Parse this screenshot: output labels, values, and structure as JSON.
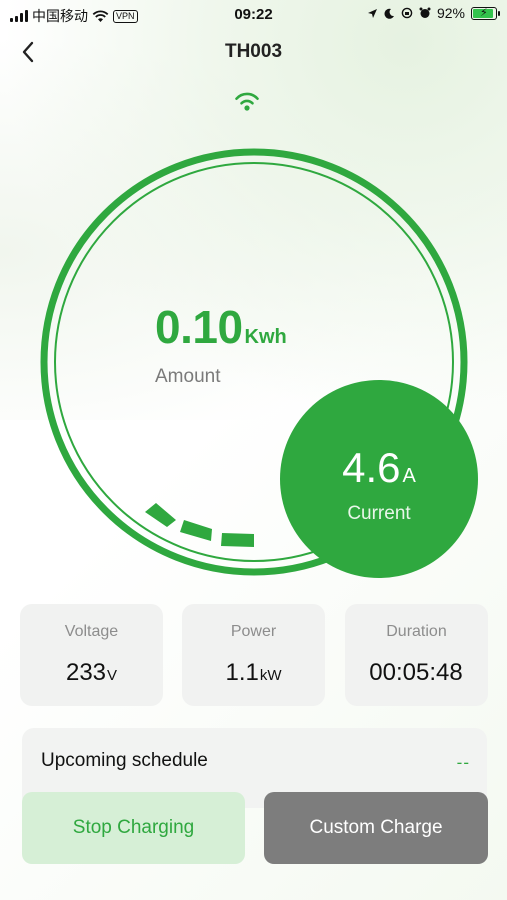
{
  "status_bar": {
    "carrier": "中国移动",
    "vpn": "VPN",
    "time": "09:22",
    "battery": "92%",
    "battery_fraction": 0.92
  },
  "nav": {
    "title": "TH003"
  },
  "charging": {
    "amount_value": "0.10",
    "amount_unit": "Kwh",
    "amount_label": "Amount",
    "current_value": "4.6",
    "current_unit": "A",
    "current_label": "Current"
  },
  "stats": [
    {
      "label": "Voltage",
      "value": "233",
      "unit": "V"
    },
    {
      "label": "Power",
      "value": "1.1",
      "unit": "kW"
    },
    {
      "label": "Duration",
      "value": "00:05:48",
      "unit": ""
    }
  ],
  "schedule": {
    "title": "Upcoming schedule",
    "value": "--"
  },
  "buttons": {
    "stop": "Stop Charging",
    "custom": "Custom Charge"
  },
  "colors": {
    "accent": "#2fa83f",
    "stop_button_bg": "#d6efd6",
    "custom_button_bg": "#7d7d7d",
    "card_bg": "#f1f2f1"
  }
}
